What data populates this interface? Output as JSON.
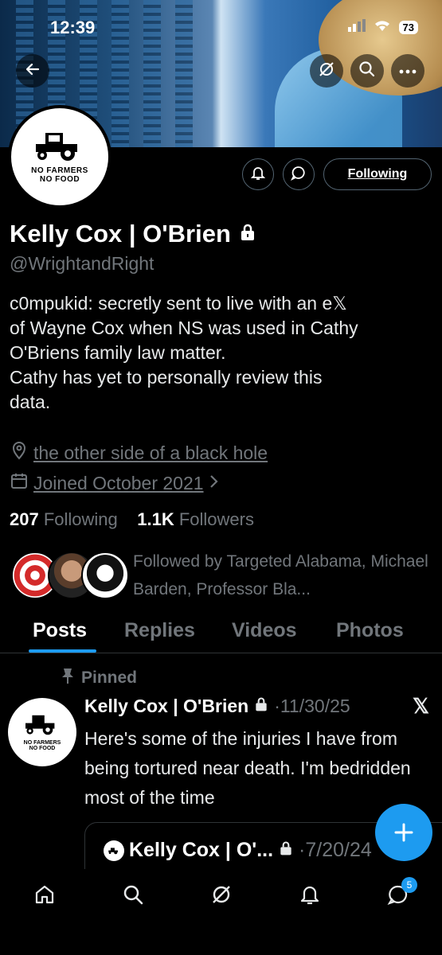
{
  "status_bar": {
    "time": "12:39",
    "battery": "73"
  },
  "profile": {
    "name": "Kelly Cox | O'Brien",
    "handle": "@WrightandRight",
    "avatar": {
      "line1": "NO FARMERS",
      "line2": "NO FOOD"
    },
    "bio": "c0mpukid: secretly sent to live with an e𝕏\nof Wayne Cox when NS was used in Cathy\nO'Briens family law matter.\nCathy has yet to personally review this\ndata.",
    "location": "the other side of a black hole",
    "joined": "Joined October 2021",
    "following_count": "207",
    "following_label": "Following",
    "followers_count": "1.1K",
    "followers_label": "Followers",
    "followed_by": "Followed by Targeted Alabama, Michael Barden, Professor Bla..."
  },
  "actions": {
    "following_button": "Following"
  },
  "tabs": [
    {
      "label": "Posts",
      "active": true
    },
    {
      "label": "Replies",
      "active": false
    },
    {
      "label": "Videos",
      "active": false
    },
    {
      "label": "Photos",
      "active": false
    }
  ],
  "pinned_post": {
    "pinned_label": "Pinned",
    "author": "Kelly Cox | O'Brien",
    "date": "·11/30/25",
    "text": "Here's some of the injuries I have from being tortured near death. I'm bedridden most of the time",
    "quote": {
      "author": "Kelly Cox | O'...",
      "date": "·7/20/24"
    }
  },
  "bottom_nav": {
    "messages_badge": "5"
  },
  "colors": {
    "accent": "#1d9bf0",
    "muted": "#71767b",
    "background": "#000000"
  }
}
